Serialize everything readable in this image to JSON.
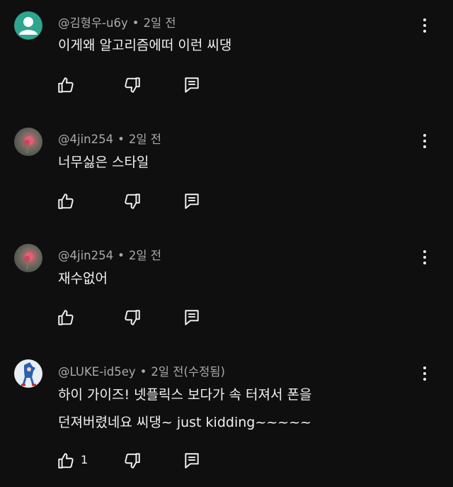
{
  "comments": [
    {
      "author": "@김형우-u6y",
      "time": "2일 전",
      "edited": "",
      "lines": [
        "이게왜 알고리즘에떠 이런 씨댕"
      ],
      "likes": "",
      "avatar_icon": "default-avatar-icon"
    },
    {
      "author": "@4jin254",
      "time": "2일 전",
      "edited": "",
      "lines": [
        "너무싫은 스타일"
      ],
      "likes": "",
      "avatar_icon": "rose-avatar-icon"
    },
    {
      "author": "@4jin254",
      "time": "2일 전",
      "edited": "",
      "lines": [
        "재수없어"
      ],
      "likes": "",
      "avatar_icon": "rose-avatar-icon"
    },
    {
      "author": "@LUKE-id5ey",
      "time": "2일 전",
      "edited": "(수정됨)",
      "lines": [
        "하이 가이즈! 넷플릭스 보다가 속 터져서 폰을",
        "던져버렸네요 씨댕~ just kidding~~~~~"
      ],
      "likes": "1",
      "avatar_icon": "character-avatar-icon"
    }
  ],
  "separator": "•",
  "icons": {
    "like": "thumbs-up-icon",
    "dislike": "thumbs-down-icon",
    "reply": "reply-comment-icon",
    "menu": "more-vertical-icon"
  },
  "colors": {
    "background": "#0f0f0f",
    "text": "#f1f1f1",
    "meta": "#aaaaaa"
  }
}
